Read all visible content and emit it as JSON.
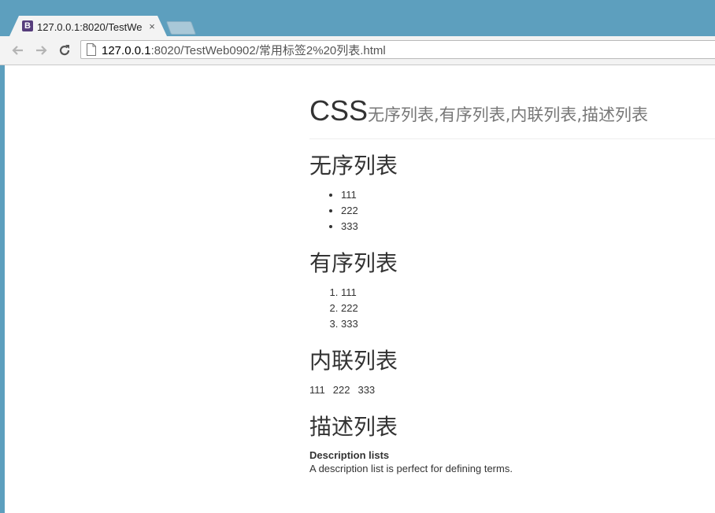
{
  "browser": {
    "tab": {
      "favicon_letter": "B",
      "title": "127.0.0.1:8020/TestWeb0902/常用标签2%20列表.html",
      "close_glyph": "×"
    },
    "address_bar": {
      "host": "127.0.0.1",
      "rest": ":8020/TestWeb0902/常用标签2%20列表.html"
    },
    "icons": {
      "back": "back-arrow-icon",
      "forward": "forward-arrow-icon",
      "reload": "reload-icon",
      "page": "page-icon"
    },
    "colors": {
      "frame": "#5d9fbe",
      "favicon": "#563d7c"
    }
  },
  "page": {
    "header": {
      "title": "CSS",
      "subtitle": "无序列表,有序列表,内联列表,描述列表"
    },
    "unordered": {
      "heading": "无序列表",
      "items": [
        "111",
        "222",
        "333"
      ]
    },
    "ordered": {
      "heading": "有序列表",
      "items": [
        "111",
        "222",
        "333"
      ]
    },
    "inline": {
      "heading": "内联列表",
      "items": [
        "111",
        "222",
        "333"
      ]
    },
    "description": {
      "heading": "描述列表",
      "term": "Description lists",
      "definition": "A description list is perfect for defining terms."
    }
  }
}
